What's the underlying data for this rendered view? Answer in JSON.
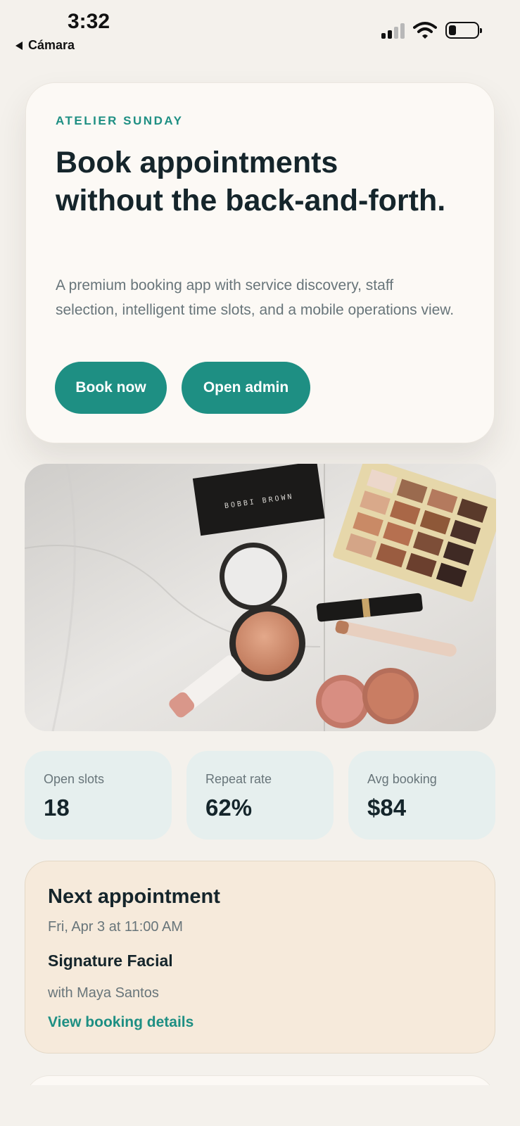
{
  "status_bar": {
    "time": "3:32",
    "back_label": "Cámara"
  },
  "hero": {
    "brand": "ATELIER SUNDAY",
    "headline": "Book appointments without the back-and-forth.",
    "description": "A premium booking app with service discovery, staff selection, intelligent time slots, and a mobile operations view.",
    "primary_button": "Book now",
    "secondary_button": "Open admin"
  },
  "photo": {
    "brand_on_box": "BOBBI BROWN"
  },
  "stats": [
    {
      "label": "Open slots",
      "value": "18"
    },
    {
      "label": "Repeat rate",
      "value": "62%"
    },
    {
      "label": "Avg booking",
      "value": "$84"
    }
  ],
  "next_appointment": {
    "title": "Next appointment",
    "date": "Fri, Apr 3 at 11:00 AM",
    "service": "Signature Facial",
    "staff": "with Maya Santos",
    "link": "View booking details"
  },
  "colors": {
    "accent": "#1e8f83",
    "background": "#f4f1ec",
    "card": "#fcf9f5",
    "stat_bg": "#e6efee",
    "next_bg": "#f6eadb"
  }
}
